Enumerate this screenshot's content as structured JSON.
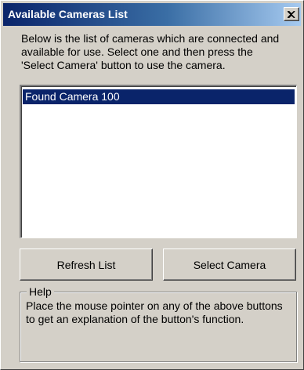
{
  "window": {
    "title": "Available Cameras List",
    "close_icon": "close-icon"
  },
  "description": "Below is the list of cameras which are connected and\navailable for use.   Select one and then press the\n'Select Camera'  button to use the camera.",
  "camera_list": {
    "items": [
      {
        "label": "Found Camera 100",
        "selected": true
      }
    ]
  },
  "buttons": {
    "refresh_label": "Refresh List",
    "select_label": "Select Camera"
  },
  "help": {
    "title": "Help",
    "text": "Place the  mouse pointer on any of the above buttons\nto get an explanation of the button's function."
  },
  "colors": {
    "face": "#d4d0c8",
    "titlebar_start": "#0a246a",
    "titlebar_end": "#a6caf0",
    "selection": "#0a246a"
  }
}
